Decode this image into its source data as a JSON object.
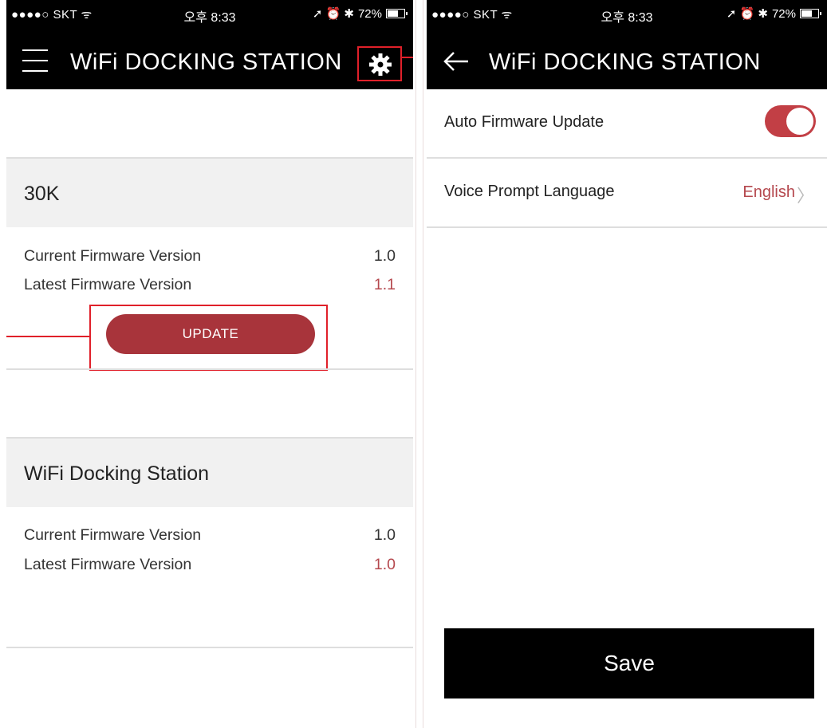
{
  "status_bar": {
    "carrier": "●●●●○ SKT ᯤ",
    "time": "오후 8:33",
    "icons": "➚ ⏰ ✱",
    "battery": "72%",
    "battery_level": 0.72
  },
  "left_screen": {
    "title": "WiFi DOCKING STATION",
    "menu_icon": "hamburger-menu-icon",
    "settings_icon": "gear-icon",
    "sections": [
      {
        "header": "30K",
        "current_label": "Current Firmware Version",
        "current_value": "1.0",
        "latest_label": "Latest Firmware Version",
        "latest_value": "1.1",
        "button_label": "UPDATE"
      },
      {
        "header": "WiFi Docking Station",
        "current_label": "Current Firmware Version",
        "current_value": "1.0",
        "latest_label": "Latest Firmware Version",
        "latest_value": "1.0"
      }
    ]
  },
  "right_screen": {
    "title": "WiFi DOCKING STATION",
    "back_icon": "back-arrow-icon",
    "auto_update_label": "Auto Firmware Update",
    "auto_update_enabled": true,
    "voice_label": "Voice Prompt Language",
    "voice_value": "English",
    "save_label": "Save"
  },
  "colors": {
    "accent_red": "#a8343b",
    "value_red": "#b5484e",
    "highlight": "#e0202a",
    "bar": "#000000"
  }
}
